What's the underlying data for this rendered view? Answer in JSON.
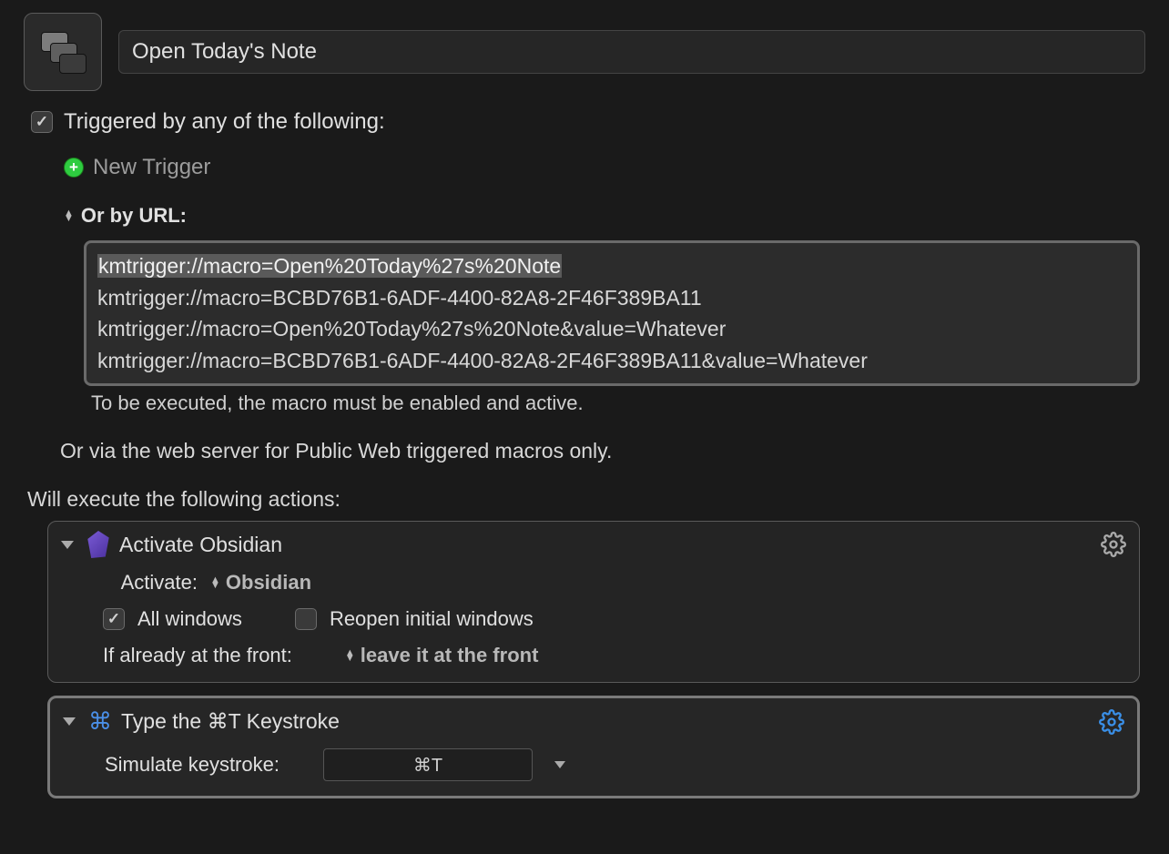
{
  "macro": {
    "title": "Open Today's Note"
  },
  "triggers": {
    "heading": "Triggered by any of the following:",
    "new_trigger_label": "New Trigger",
    "url_heading": "Or by URL:",
    "urls": [
      "kmtrigger://macro=Open%20Today%27s%20Note",
      "kmtrigger://macro=BCBD76B1-6ADF-4400-82A8-2F46F389BA11",
      "kmtrigger://macro=Open%20Today%27s%20Note&value=Whatever",
      "kmtrigger://macro=BCBD76B1-6ADF-4400-82A8-2F46F389BA11&value=Whatever"
    ],
    "url_hint": "To be executed, the macro must be enabled and active.",
    "web_hint": "Or via the web server for Public Web triggered macros only."
  },
  "actions_heading": "Will execute the following actions:",
  "actions": {
    "activate": {
      "title": "Activate Obsidian",
      "activate_label": "Activate:",
      "app_name": "Obsidian",
      "all_windows_label": "All windows",
      "reopen_label": "Reopen initial windows",
      "front_label": "If already at the front:",
      "front_value": "leave it at the front"
    },
    "keystroke": {
      "title": "Type the ⌘T Keystroke",
      "sim_label": "Simulate keystroke:",
      "keys": "⌘T"
    }
  }
}
